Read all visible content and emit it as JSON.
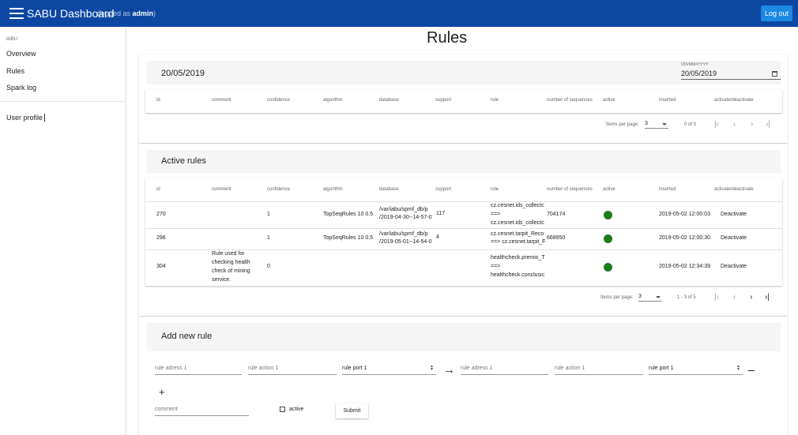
{
  "topbar": {
    "title": "SABU Dashboard",
    "logged_prefix": "(logged as ",
    "user": "admin",
    "logged_suffix": ")",
    "logout_label": "Log out"
  },
  "sidebar": {
    "section": "IABU",
    "items": [
      {
        "label": "Overview"
      },
      {
        "label": "Rules"
      },
      {
        "label": "Spark log"
      }
    ],
    "profile": "User profile"
  },
  "page_title": "Rules",
  "columns": [
    "id",
    "comment",
    "confidence",
    "algorithm",
    "database",
    "support",
    "rule",
    "number of sequences",
    "active",
    "inserted",
    "activate/deactivate"
  ],
  "date_card": {
    "date_heading": "20/05/2019",
    "date_label": "DD/MM/YYYY",
    "date_value": "20/05/2019",
    "items_per_page_label": "Items per page:",
    "items_per_page": "3",
    "range": "0 of 0"
  },
  "active_card": {
    "heading": "Active rules",
    "rows": [
      {
        "id": "270",
        "comment": "",
        "confidence": "1",
        "algorithm": "TopSeqRules 10 0.5",
        "database_1": "/var/iabu/spmf_db/p",
        "database_2": "/2019-04-30--14-57-0",
        "support": "117",
        "rule_1": "cz.cesnet.ids_collectc",
        "rule_2": "==>",
        "rule_3": "cz.cesnet.ids_collectc",
        "sequences": "704174",
        "active": true,
        "inserted": "2019-05-02 12:00:03",
        "action": "Deactivate"
      },
      {
        "id": "296",
        "comment": "",
        "confidence": "1",
        "algorithm": "TopSeqRules 10 0.5",
        "database_1": "/var/iabu/spmf_db/p",
        "database_2": "/2019-05-01--14-54-0",
        "support": "4",
        "rule_1": "cz.cesnet.tarpit_Reco",
        "rule_2": "==> cz.cesnet.tarpit_F",
        "rule_3": "",
        "sequences": "668950",
        "active": true,
        "inserted": "2019-05-02 12:00:30",
        "action": "Deactivate"
      },
      {
        "id": "304",
        "comment_1": "Rule used for",
        "comment_2": "checking health",
        "comment_3": "check of mining",
        "comment_4": "service.",
        "confidence": "0",
        "algorithm": "",
        "database_1": "",
        "database_2": "",
        "support": "",
        "rule_1": "healthcheck.premis_T",
        "rule_2": "==>",
        "rule_3": "healthcheck.conclusic",
        "sequences": "",
        "active": true,
        "inserted": "2019-05-02 12:34:39",
        "action": "Deactivate"
      }
    ],
    "items_per_page_label": "Items per page:",
    "items_per_page": "3",
    "range": "1 - 3 of 5"
  },
  "add_card": {
    "heading": "Add new rule",
    "left": {
      "address_placeholder": "rule adress 1",
      "action_placeholder": "rule action 1",
      "port_value": "rule port 1"
    },
    "right": {
      "address_placeholder": "rule adress 1",
      "action_placeholder": "rule action 1",
      "port_value": "rule port 1"
    },
    "comment_placeholder": "comment",
    "active_label": "active",
    "submit_label": "Submit"
  },
  "colors": {
    "topbar": "#0d47a1",
    "logout": "#1e88e5",
    "active_dot": "#1b7d1f"
  }
}
